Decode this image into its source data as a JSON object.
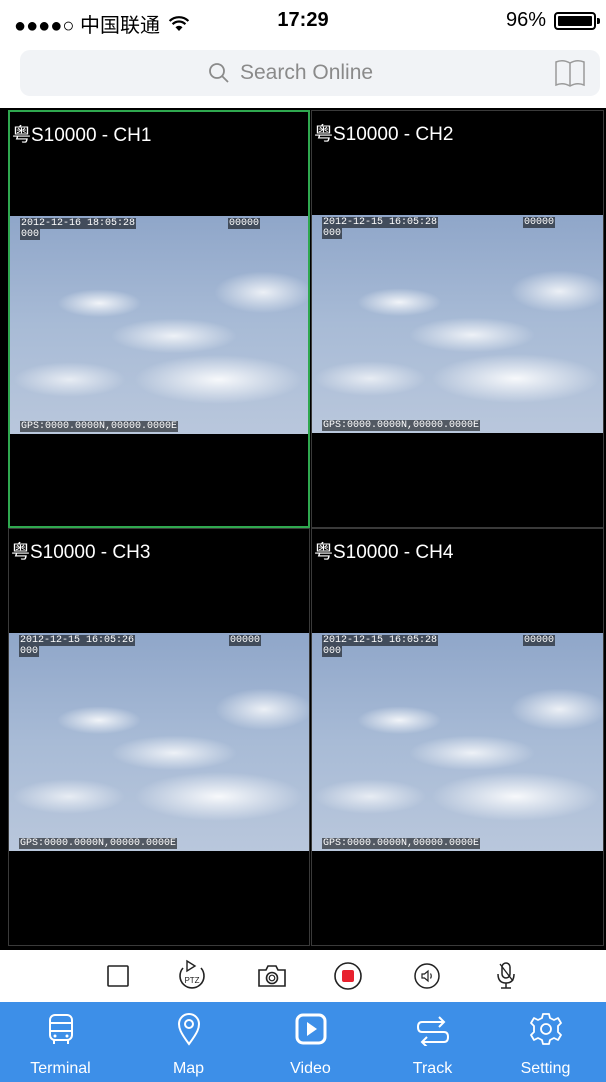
{
  "status": {
    "carrier": "●●●●○ 中国联通",
    "time": "17:29",
    "battery": "96%"
  },
  "search": {
    "placeholder": "Search Online"
  },
  "tiles": [
    {
      "label": "粤S10000 - CH1",
      "osd_date": "2012-12-16 18:05:28",
      "osd_code": "00000",
      "osd_sub": "000",
      "osd_gps": "GPS:0000.0000N,00000.0000E",
      "active": true
    },
    {
      "label": "粤S10000 - CH2",
      "osd_date": "2012-12-15 16:05:28",
      "osd_code": "00000",
      "osd_sub": "000",
      "osd_gps": "GPS:0000.0000N,00000.0000E",
      "active": false
    },
    {
      "label": "粤S10000 - CH3",
      "osd_date": "2012-12-15 16:05:26",
      "osd_code": "00000",
      "osd_sub": "000",
      "osd_gps": "GPS:0000.0000N,00000.0000E",
      "active": false
    },
    {
      "label": "粤S10000 - CH4",
      "osd_date": "2012-12-15 16:05:28",
      "osd_code": "00000",
      "osd_sub": "000",
      "osd_gps": "GPS:0000.0000N,00000.0000E",
      "active": false
    }
  ],
  "controls": {
    "ptz_label": "PTZ",
    "icons": [
      "square-layout-icon",
      "ptz-rotate-icon",
      "camera-icon",
      "record-icon",
      "speaker-icon",
      "microphone-icon"
    ],
    "record_color": "#e8212e"
  },
  "tabs": [
    {
      "label": "Terminal",
      "icon": "bus-icon"
    },
    {
      "label": "Map",
      "icon": "map-pin-icon"
    },
    {
      "label": "Video",
      "icon": "video-play-icon"
    },
    {
      "label": "Track",
      "icon": "track-arrows-icon"
    },
    {
      "label": "Setting",
      "icon": "gear-icon"
    }
  ],
  "colors": {
    "tab_bar": "#3d8fe8",
    "active_tile_border": "#2fa84f"
  }
}
